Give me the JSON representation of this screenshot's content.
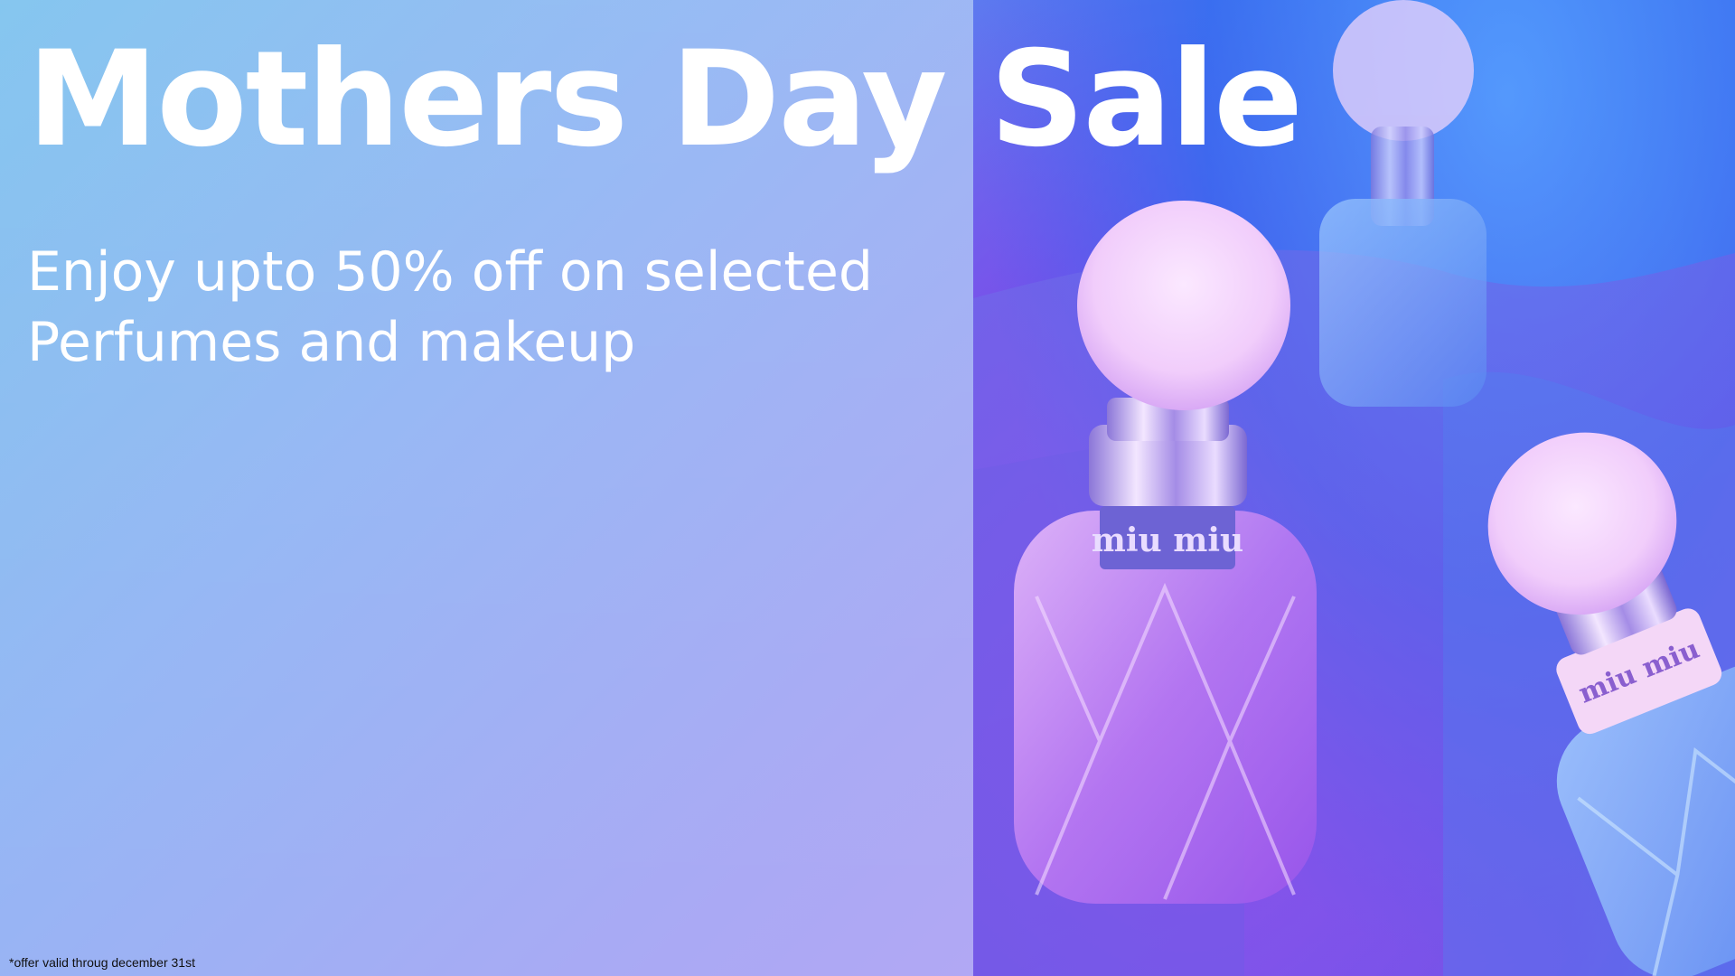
{
  "banner": {
    "title": "Mothers Day Sale",
    "subtitle": "Enjoy upto 50% off on selected Perfumes and makeup",
    "footnote": "*offer valid throug december 31st"
  },
  "photo": {
    "bottle_brand_front": "miu miu",
    "bottle_brand_right": "miu miu",
    "bottle_brand_label_lower": "miu miu"
  },
  "colors": {
    "title_text": "#ffffff",
    "gradient_start": "#7fc3ee",
    "gradient_end": "#c3a4f6",
    "photo_tint_blue": "#3a7ff0",
    "photo_tint_purple": "#8b5aee",
    "footnote_text": "#111111"
  }
}
